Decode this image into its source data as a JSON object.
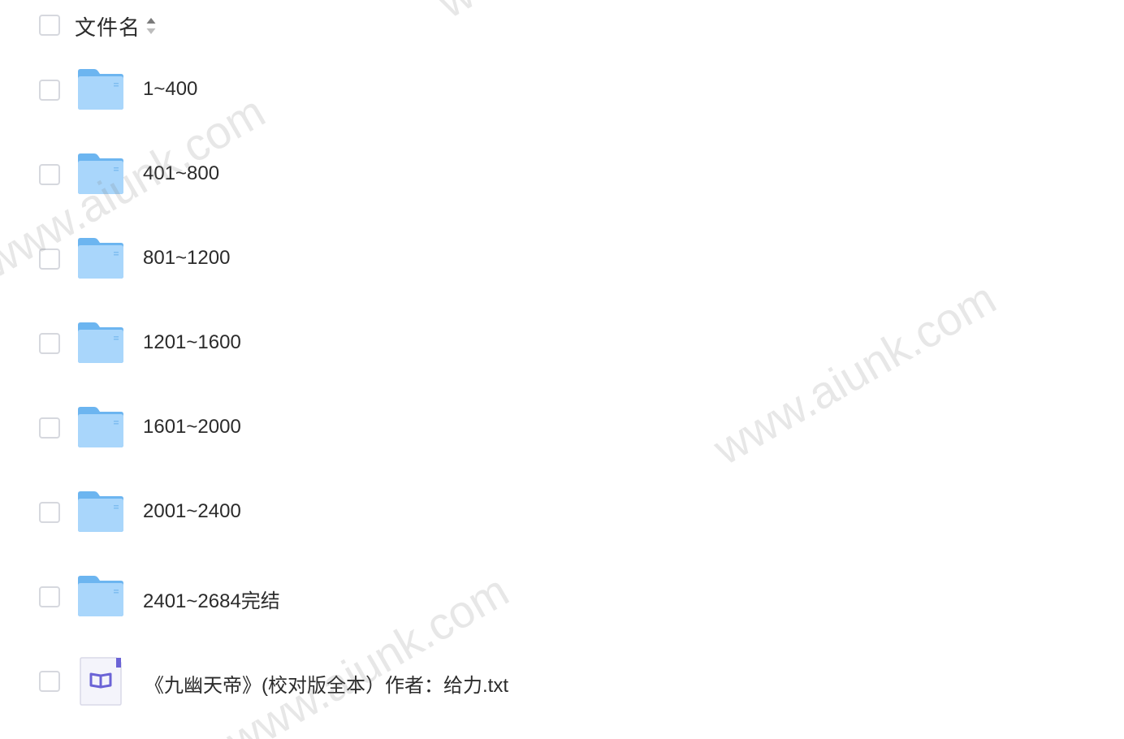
{
  "header": {
    "label": "文件名"
  },
  "rows": [
    {
      "type": "folder",
      "name": "1~400"
    },
    {
      "type": "folder",
      "name": "401~800"
    },
    {
      "type": "folder",
      "name": "801~1200"
    },
    {
      "type": "folder",
      "name": "1201~1600"
    },
    {
      "type": "folder",
      "name": "1601~2000"
    },
    {
      "type": "folder",
      "name": "2001~2400"
    },
    {
      "type": "folder",
      "name": "2401~2684完结"
    },
    {
      "type": "file",
      "name": "《九幽天帝》(校对版全本）作者：给力.txt",
      "icon": "book-icon"
    }
  ],
  "watermark": "www.aiunk.com",
  "colors": {
    "folder_light": "#a9d6fb",
    "folder_dark": "#6cb5f0",
    "book_accent": "#6b63d6",
    "checkbox_border": "#d6d8de"
  }
}
